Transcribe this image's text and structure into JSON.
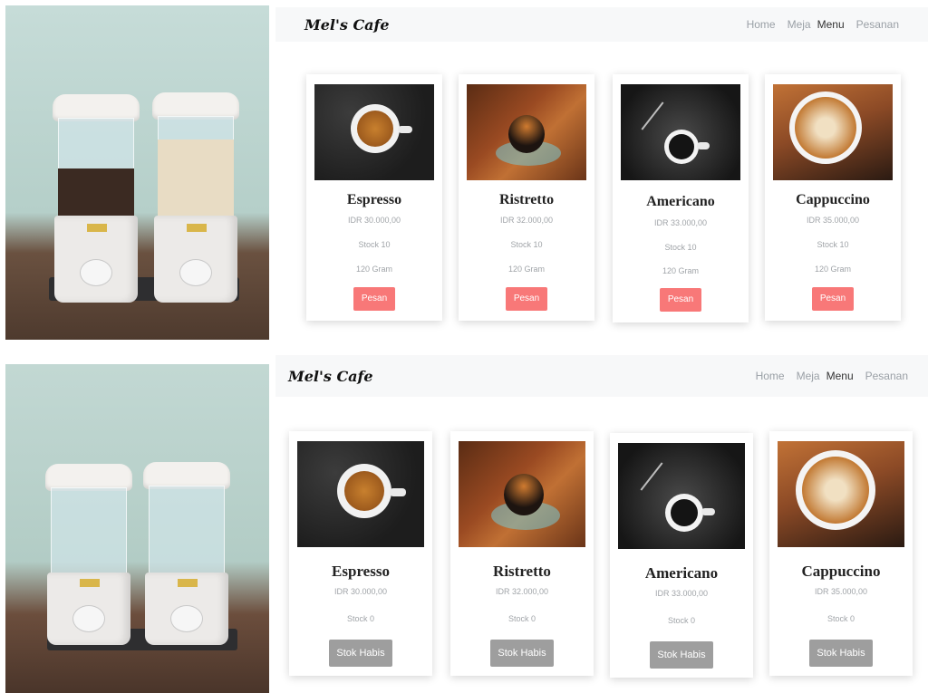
{
  "brand": "Mel's Cafe",
  "nav": [
    "Home",
    "Meja",
    "Menu",
    "Pesanan"
  ],
  "active_nav": "Menu",
  "screen_top": {
    "cards": [
      {
        "name": "Espresso",
        "price": "IDR 30.000,00",
        "stock": "Stock 10",
        "weight": "120 Gram",
        "button": "Pesan"
      },
      {
        "name": "Ristretto",
        "price": "IDR 32.000,00",
        "stock": "Stock 10",
        "weight": "120 Gram",
        "button": "Pesan"
      },
      {
        "name": "Americano",
        "price": "IDR 33.000,00",
        "stock": "Stock 10",
        "weight": "120 Gram",
        "button": "Pesan"
      },
      {
        "name": "Cappuccino",
        "price": "IDR 35.000,00",
        "stock": "Stock 10",
        "weight": "120 Gram",
        "button": "Pesan"
      }
    ]
  },
  "screen_bottom": {
    "cards": [
      {
        "name": "Espresso",
        "price": "IDR 30.000,00",
        "stock": "Stock 0",
        "button": "Stok Habis"
      },
      {
        "name": "Ristretto",
        "price": "IDR 32.000,00",
        "stock": "Stock 0",
        "button": "Stok Habis"
      },
      {
        "name": "Americano",
        "price": "IDR 33.000,00",
        "stock": "Stock 0",
        "button": "Stok Habis"
      },
      {
        "name": "Cappuccino",
        "price": "IDR 35.000,00",
        "stock": "Stock 0",
        "button": "Stok Habis"
      }
    ]
  },
  "colors": {
    "navbar_bg": "#f7f8f9",
    "order_button": "#f87878",
    "sold_out_button": "#9e9e9e",
    "muted_text": "#a0a4a8"
  }
}
